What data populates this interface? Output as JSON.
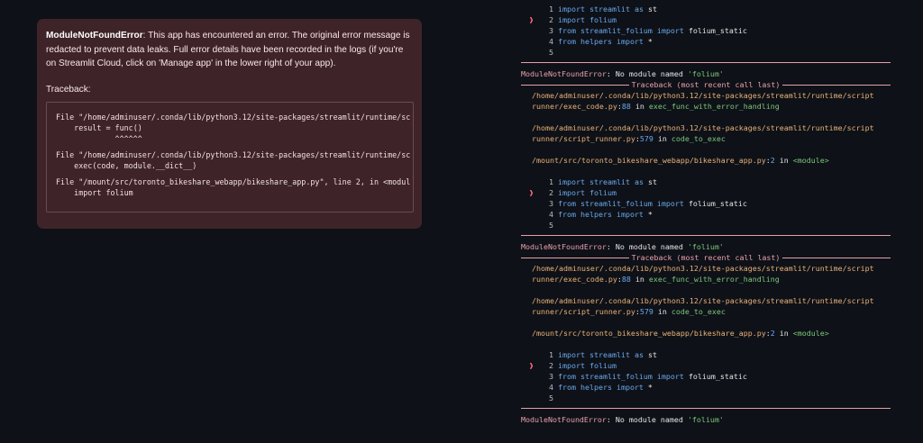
{
  "error_card": {
    "title": "ModuleNotFoundError",
    "message": ": This app has encountered an error. The original error message is redacted to prevent data leaks. Full error details have been recorded in the logs (if you're on Streamlit Cloud, click on 'Manage app' in the lower right of your app).",
    "traceback_label": "Traceback:",
    "traceback_lines": [
      "File \"/home/adminuser/.conda/lib/python3.12/site-packages/streamlit/runtime/sc",
      "    result = func()",
      "             ^^^^^^",
      "File \"/home/adminuser/.conda/lib/python3.12/site-packages/streamlit/runtime/sc",
      "    exec(code, module.__dict__)",
      "File \"/mount/src/toronto_bikeshare_webapp/bikeshare_app.py\", line 2, in <modul",
      "    import folium"
    ]
  },
  "terminal": {
    "code": [
      {
        "n": "1",
        "kw": "import",
        "mod": "streamlit",
        "kw2": "as",
        "rest": " st"
      },
      {
        "n": "2",
        "kw": "import",
        "mod": "folium",
        "kw2": "",
        "rest": ""
      },
      {
        "n": "3",
        "kw": "from",
        "mod": "streamlit_folium",
        "kw2": "import",
        "rest": " folium_static"
      },
      {
        "n": "4",
        "kw": "from",
        "mod": "helpers",
        "kw2": "import",
        "rest": " *"
      },
      {
        "n": "5",
        "kw": "",
        "mod": "",
        "kw2": "",
        "rest": ""
      }
    ],
    "arrow": "❱",
    "error_name": "ModuleNotFoundError",
    "error_text": ": No module named ",
    "error_module": "'folium'",
    "traceback_title": "Traceback (most recent call last)",
    "frames": [
      {
        "path1": "/home/adminuser/.conda/lib/python3.12/site-packages/streamlit/runtime/script",
        "path2": "runner/exec_code.py",
        "line": "88",
        "fn": "exec_func_with_error_handling"
      },
      {
        "path1": "/home/adminuser/.conda/lib/python3.12/site-packages/streamlit/runtime/script",
        "path2": "runner/script_runner.py",
        "line": "579",
        "fn": "code_to_exec"
      },
      {
        "path1": "",
        "path2": "/mount/src/toronto_bikeshare_webapp/bikeshare_app.py",
        "line": "2",
        "fn": "<module>"
      }
    ],
    "in_word": " in "
  }
}
